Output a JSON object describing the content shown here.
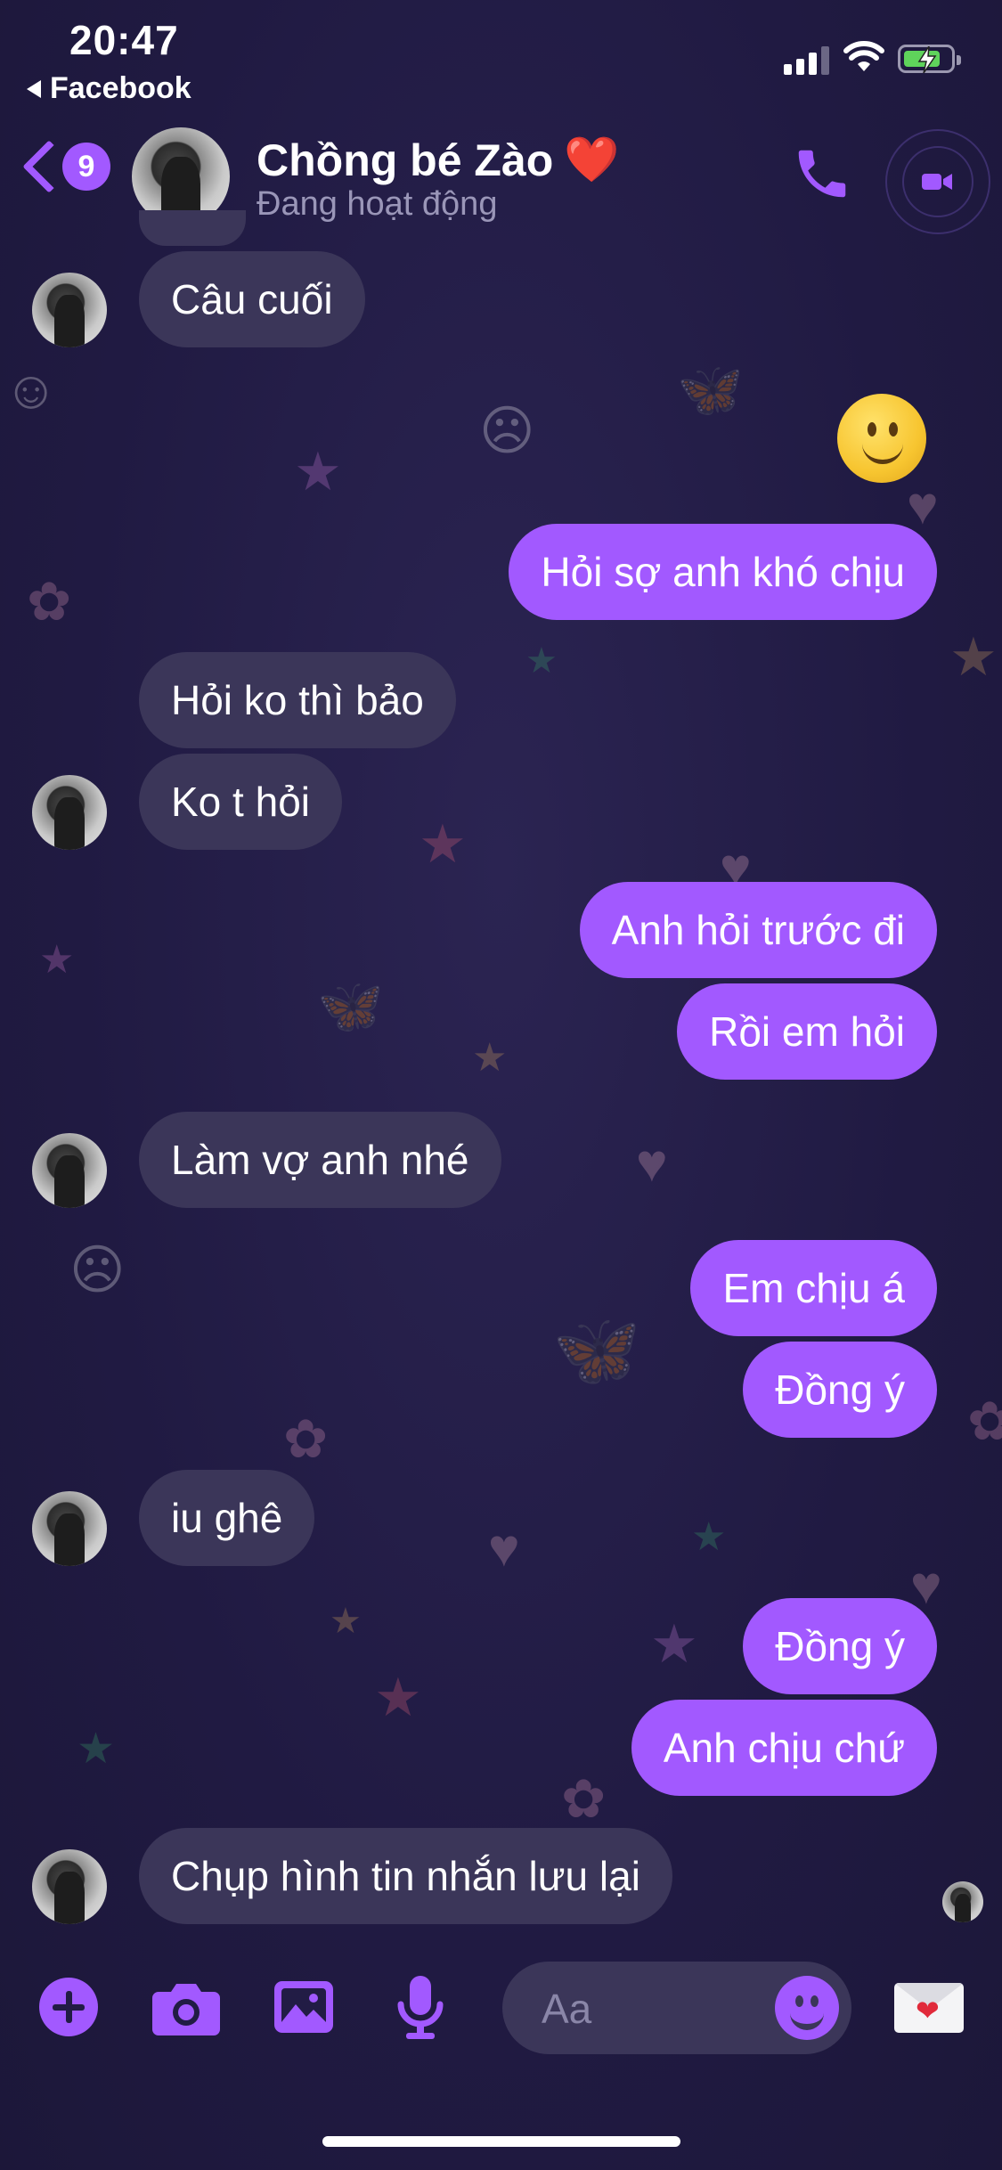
{
  "status_bar": {
    "time": "20:47",
    "back_app": "Facebook"
  },
  "header": {
    "unread_count": "9",
    "contact_name": "Chồng bé Zào",
    "contact_emoji": "❤️",
    "presence": "Đang hoạt động",
    "icons": [
      "back-chevron-icon",
      "phone-icon",
      "video-camera-icon"
    ]
  },
  "messages": [
    {
      "side": "in",
      "text": "Câu cuối"
    },
    {
      "side": "out",
      "text": "🙂",
      "type": "emoji"
    },
    {
      "side": "out",
      "text": "Hỏi sợ anh khó chịu"
    },
    {
      "side": "in",
      "text": "Hỏi ko thì bảo"
    },
    {
      "side": "in",
      "text": "Ko t hỏi"
    },
    {
      "side": "out",
      "text": "Anh hỏi trước đi"
    },
    {
      "side": "out",
      "text": "Rồi em hỏi"
    },
    {
      "side": "in",
      "text": "Làm vợ anh nhé"
    },
    {
      "side": "out",
      "text": "Em chịu á"
    },
    {
      "side": "out",
      "text": "Đồng ý"
    },
    {
      "side": "in",
      "text": "iu ghê"
    },
    {
      "side": "out",
      "text": "Đồng ý"
    },
    {
      "side": "out",
      "text": "Anh chịu chứ"
    },
    {
      "side": "in",
      "text": "Chụp hình tin nhắn lưu lại"
    }
  ],
  "composer": {
    "placeholder": "Aa",
    "icons": [
      "plus-icon",
      "camera-icon",
      "gallery-icon",
      "microphone-icon",
      "emoji-icon",
      "heart-envelope-icon"
    ]
  },
  "colors": {
    "accent": "#a259ff",
    "background": "#221c45",
    "incoming_bubble": "#3b3659",
    "heart": "#e8283a"
  }
}
